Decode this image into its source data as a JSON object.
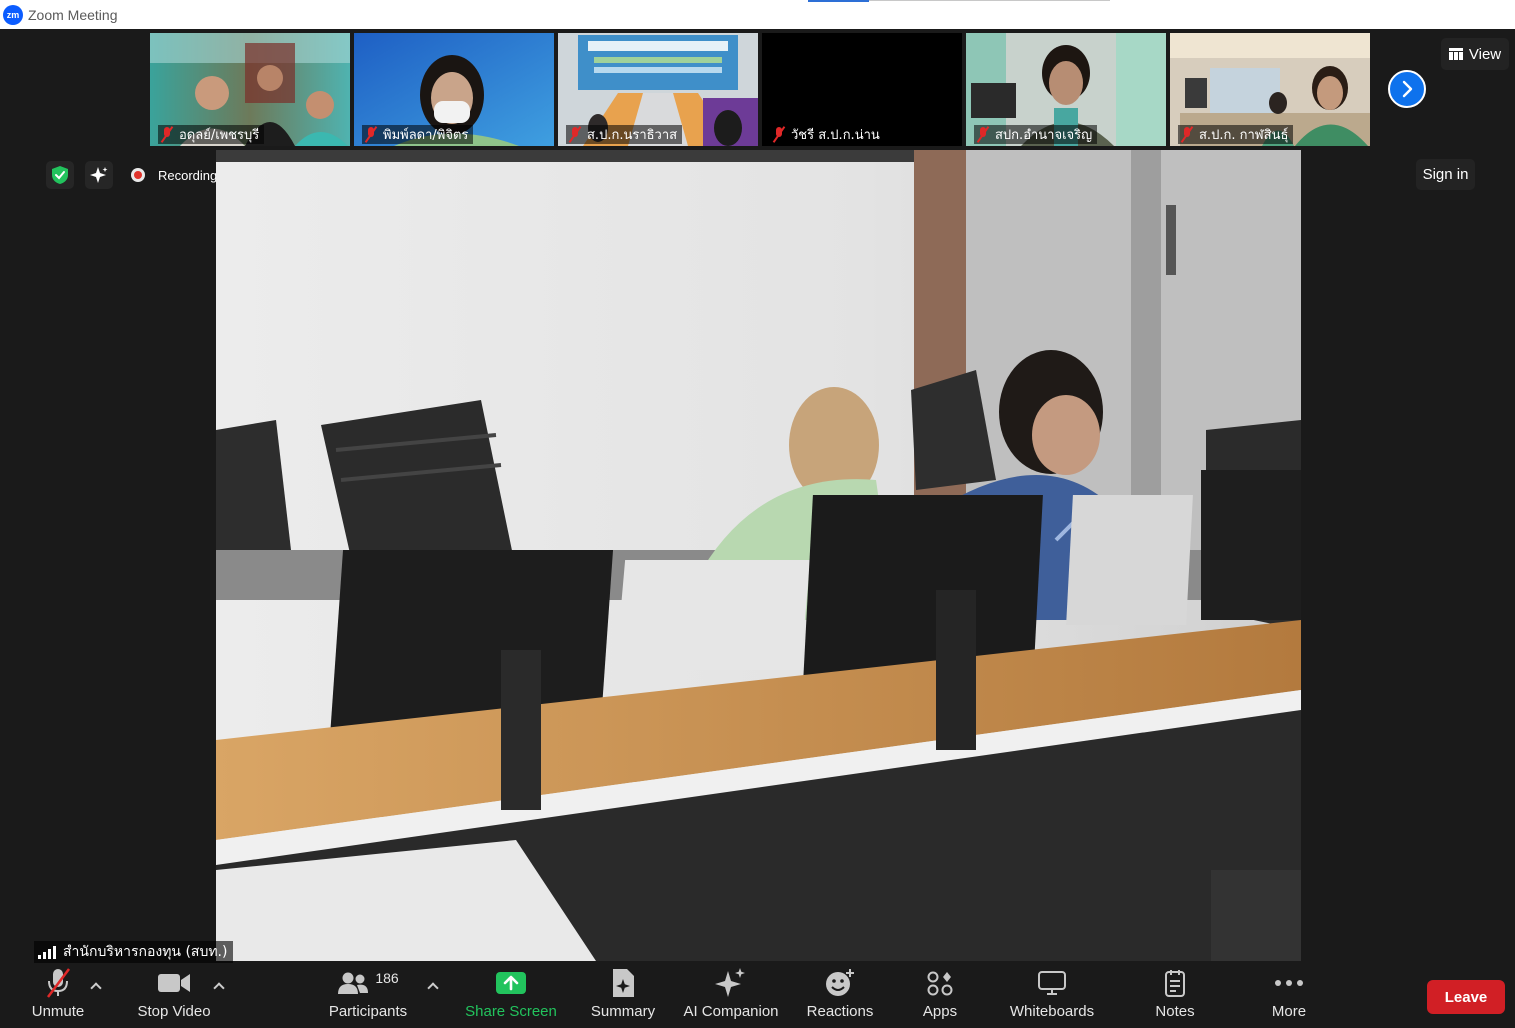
{
  "window": {
    "title": "Zoom Meeting",
    "logo_text": "zm"
  },
  "thumbnails": [
    {
      "name": "อดุลย์/เพชรบุรี"
    },
    {
      "name": "พิมพ์ลดา/พิจิตร"
    },
    {
      "name": "ส.ป.ก.นราธิวาส"
    },
    {
      "name": "วัชรี ส.ป.ก.น่าน"
    },
    {
      "name": "สปก.อำนาจเจริญ"
    },
    {
      "name": "ส.ป.ก. กาฬสินธุ์"
    }
  ],
  "header": {
    "view_label": "View",
    "sign_in_label": "Sign in",
    "recording_label": "Recording"
  },
  "main_video": {
    "speaker_name": "สำนักบริหารกองทุน (สบท.)"
  },
  "toolbar": {
    "unmute": "Unmute",
    "stop_video": "Stop Video",
    "participants": "Participants",
    "participants_count": "186",
    "share_screen": "Share Screen",
    "summary": "Summary",
    "ai_companion": "AI Companion",
    "reactions": "Reactions",
    "apps": "Apps",
    "whiteboards": "Whiteboards",
    "notes": "Notes",
    "more": "More",
    "leave": "Leave"
  },
  "colors": {
    "accent_blue": "#0e72ed",
    "share_green": "#22c35d",
    "leave_red": "#d11f25",
    "mic_off_red": "#e02828"
  }
}
